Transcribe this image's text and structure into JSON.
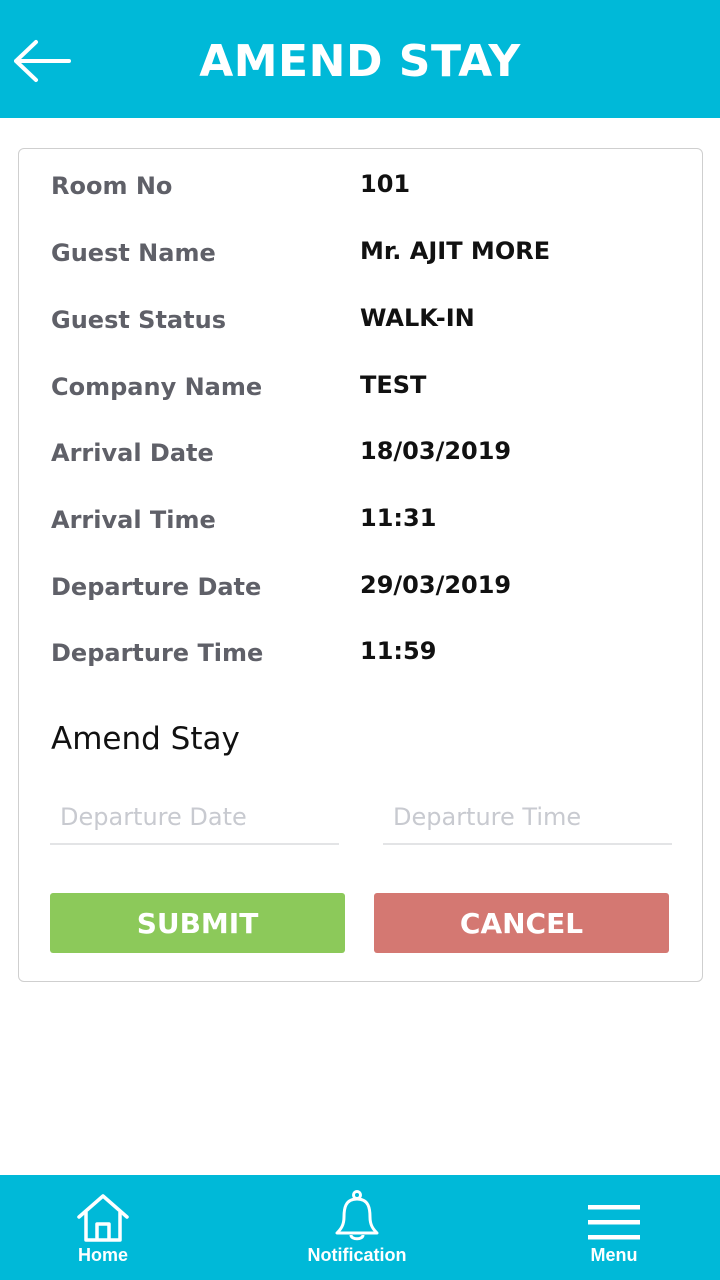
{
  "header": {
    "title": "AMEND STAY"
  },
  "details": [
    {
      "label": "Room No",
      "value": "101"
    },
    {
      "label": "Guest Name",
      "value": "Mr. AJIT MORE"
    },
    {
      "label": "Guest Status",
      "value": "WALK-IN"
    },
    {
      "label": "Company Name",
      "value": "TEST"
    },
    {
      "label": "Arrival Date",
      "value": "18/03/2019"
    },
    {
      "label": "Arrival Time",
      "value": "11:31"
    },
    {
      "label": "Departure Date",
      "value": "29/03/2019"
    },
    {
      "label": "Departure Time",
      "value": "11:59"
    }
  ],
  "amend": {
    "title": "Amend Stay",
    "departure_date_placeholder": "Departure Date",
    "departure_time_placeholder": "Departure Time",
    "departure_date_value": "",
    "departure_time_value": "",
    "submit_label": "SUBMIT",
    "cancel_label": "CANCEL"
  },
  "nav": {
    "home_label": "Home",
    "notification_label": "Notification",
    "menu_label": "Menu"
  },
  "colors": {
    "brand": "#00b9d8",
    "submit": "#8cc95a",
    "cancel": "#d47872"
  },
  "icons": {
    "back": "arrow-left-icon",
    "home": "home-icon",
    "notification": "bell-icon",
    "menu": "hamburger-icon"
  }
}
